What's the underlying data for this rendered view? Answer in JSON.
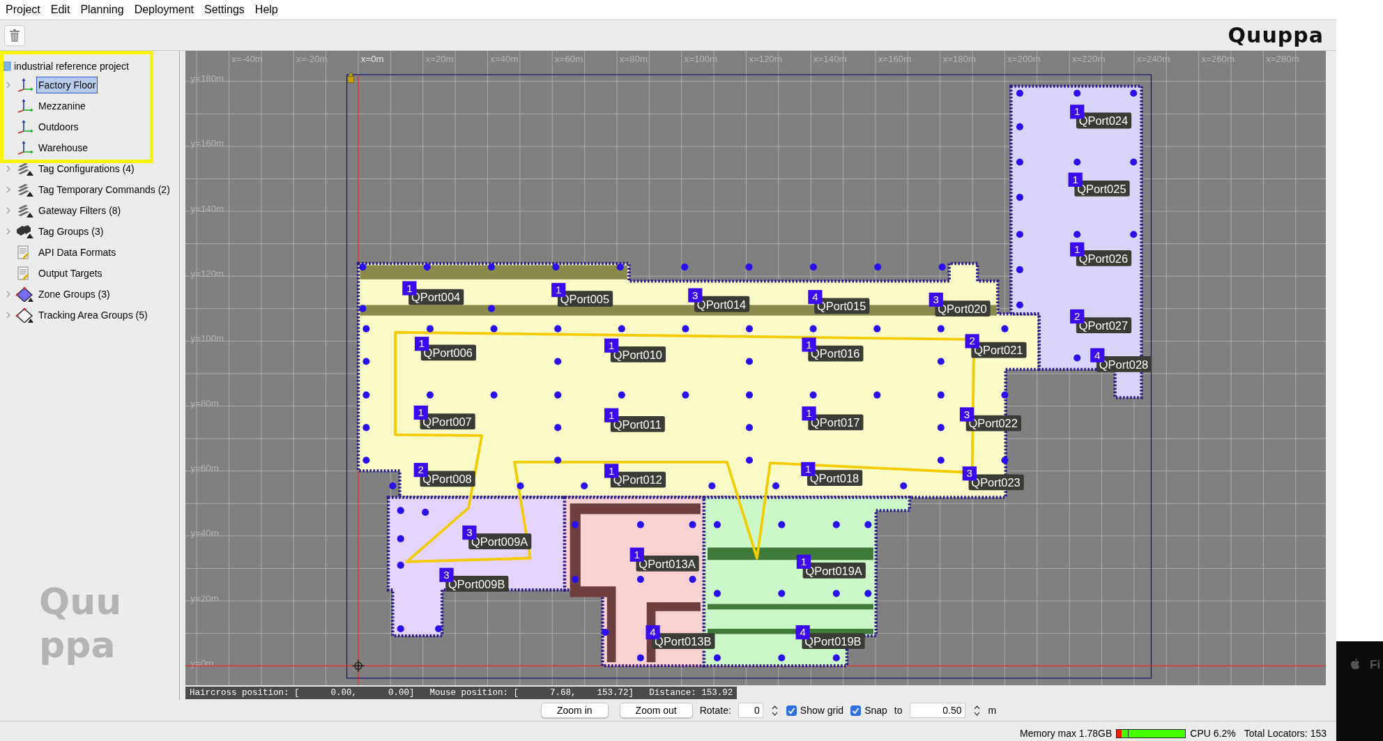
{
  "menu": [
    "Project",
    "Edit",
    "Planning",
    "Deployment",
    "Settings",
    "Help"
  ],
  "logo": "Quuppa",
  "tree": {
    "root": "industrial reference project",
    "items": [
      {
        "label": "Factory Floor",
        "kind": "axes",
        "has_children": true,
        "selected": true
      },
      {
        "label": "Mezzanine",
        "kind": "axes",
        "has_children": false,
        "selected": false
      },
      {
        "label": "Outdoors",
        "kind": "axes",
        "has_children": false,
        "selected": false
      },
      {
        "label": "Warehouse",
        "kind": "axes",
        "has_children": false,
        "selected": false
      },
      {
        "label": "Tag Configurations (4)",
        "kind": "wrench",
        "has_children": true,
        "selected": false
      },
      {
        "label": "Tag Temporary Commands (2)",
        "kind": "wrench",
        "has_children": true,
        "selected": false
      },
      {
        "label": "Gateway Filters (8)",
        "kind": "wrench",
        "has_children": true,
        "selected": false
      },
      {
        "label": "Tag Groups (3)",
        "kind": "tags",
        "has_children": true,
        "selected": false
      },
      {
        "label": "API Data Formats",
        "kind": "document",
        "has_children": false,
        "selected": false
      },
      {
        "label": "Output Targets",
        "kind": "document",
        "has_children": false,
        "selected": false
      },
      {
        "label": "Zone Groups (3)",
        "kind": "zone",
        "has_children": true,
        "selected": false
      },
      {
        "label": "Tracking Area Groups (5)",
        "kind": "area",
        "has_children": true,
        "selected": false
      }
    ],
    "panel_logo": [
      "Quu",
      "ppa"
    ]
  },
  "map": {
    "x_labels": [
      "x=-40m",
      "x=-20m",
      "x=0m",
      "x=20m",
      "x=40m",
      "x=60m",
      "x=80m",
      "x=100m",
      "x=120m",
      "x=140m",
      "x=160m",
      "x=180m",
      "x=200m",
      "x=220m",
      "x=240m",
      "x=260m",
      "x=280m"
    ],
    "y_labels": [
      "y=180m",
      "y=160m",
      "y=140m",
      "y=120m",
      "y=100m",
      "y=80m",
      "y=60m",
      "y=40m",
      "y=20m",
      "y=0m"
    ],
    "qports": [
      {
        "name": "QPort004",
        "count": "1"
      },
      {
        "name": "QPort005",
        "count": "1"
      },
      {
        "name": "QPort014",
        "count": "3"
      },
      {
        "name": "QPort015",
        "count": "4"
      },
      {
        "name": "QPort020",
        "count": "3"
      },
      {
        "name": "QPort006",
        "count": "1"
      },
      {
        "name": "QPort010",
        "count": "1"
      },
      {
        "name": "QPort016",
        "count": "1"
      },
      {
        "name": "QPort021",
        "count": "2"
      },
      {
        "name": "QPort007",
        "count": "1"
      },
      {
        "name": "QPort011",
        "count": "1"
      },
      {
        "name": "QPort017",
        "count": "1"
      },
      {
        "name": "QPort022",
        "count": "3"
      },
      {
        "name": "QPort008",
        "count": "2"
      },
      {
        "name": "QPort012",
        "count": "1"
      },
      {
        "name": "QPort018",
        "count": "1"
      },
      {
        "name": "QPort023",
        "count": "3"
      },
      {
        "name": "QPort009A",
        "count": "3"
      },
      {
        "name": "QPort009B",
        "count": "3"
      },
      {
        "name": "QPort013A",
        "count": "1"
      },
      {
        "name": "QPort019A",
        "count": "1"
      },
      {
        "name": "QPort013B",
        "count": "4"
      },
      {
        "name": "QPort019B",
        "count": "4"
      },
      {
        "name": "QPort024",
        "count": "1"
      },
      {
        "name": "QPort025",
        "count": "1"
      },
      {
        "name": "QPort026",
        "count": "1"
      },
      {
        "name": "QPort027",
        "count": "2"
      },
      {
        "name": "QPort028",
        "count": "4"
      }
    ],
    "info": [
      "Haircross position: [      0.00,      0.00]",
      "Mouse position: [      7.68,    153.72]",
      "Distance: 153.92"
    ]
  },
  "controls": {
    "zoom_in": "Zoom in",
    "zoom_out": "Zoom out",
    "rotate_label": "Rotate:",
    "rotate_value": "0",
    "show_grid": {
      "label": "Show grid",
      "checked": true
    },
    "snap": {
      "label": "Snap",
      "checked": true
    },
    "snap_to": "to",
    "snap_value": "0.50",
    "unit": "m"
  },
  "status_bar": {
    "memory": "Memory max 1.78GB",
    "memory_meter": {
      "level": 0.07
    },
    "cpu": "CPU 6.2%",
    "locators": "Total Locators: 153"
  },
  "desktop": {
    "menu_text": "Fi"
  }
}
